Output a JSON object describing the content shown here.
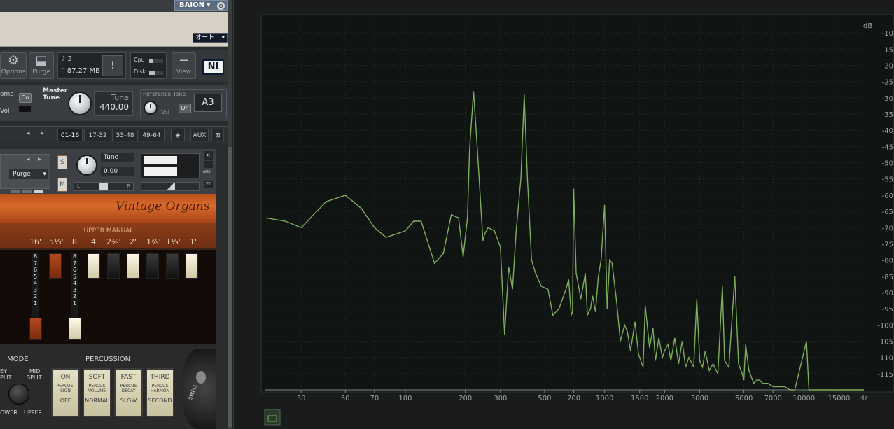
{
  "header": {
    "instrument_name": "BAION",
    "mode_dropdown": "オート"
  },
  "toolbar": {
    "options_label": "Options",
    "purge_label": "Purge",
    "view_label": "View",
    "voices": "2",
    "memory": "87.27 MB",
    "alert": "!",
    "cpu_label": "Cpu",
    "disk_label": "Disk",
    "cpu_level": 0.25,
    "disk_level": 0.45,
    "logo": "NI"
  },
  "master": {
    "metronome_label": "ome",
    "on": "On",
    "vol_label": "Vol",
    "master_tune_label": "Master\nTune",
    "tune_title": "Tune",
    "tune_value": "440.00",
    "reference_tone_label": "Reference Tone",
    "ref_vol_label": "Vol",
    "ref_on": "On",
    "ref_note": "A3"
  },
  "rack": {
    "pages": [
      "01-16",
      "17-32",
      "33-48",
      "49-64"
    ],
    "aux_label": "AUX"
  },
  "instrument": {
    "purge_label": "Purge",
    "s_label": "S",
    "m_label": "M",
    "tune_label": "Tune",
    "tune_value": "0.00",
    "pan_left": "L",
    "pan_right": "R",
    "aux_small": "AUX",
    "pv_small": "PV",
    "brand": "Vintage Organs"
  },
  "organ": {
    "manual_label": "UPPER MANUAL",
    "footages": [
      "16'",
      "5⅓'",
      "8'",
      "4'",
      "2⅔'",
      "2'",
      "1⅗'",
      "1⅓'",
      "1'"
    ],
    "drawbar_levels": [
      8,
      0,
      8,
      0,
      0,
      0,
      0,
      0,
      0
    ],
    "scale_numbers": [
      "8",
      "7",
      "6",
      "5",
      "4",
      "3",
      "2",
      "1"
    ],
    "mode_label": "MODE",
    "percussion_label": "PERCUSSION",
    "mode_labels": {
      "key_split": "EY\nPLIT",
      "midi_split": "MIDI\nSPLIT",
      "lower": "OWER",
      "upper": "UPPER"
    },
    "percussion_buttons": [
      {
        "top": "ON",
        "mid": "PERCUS-\nSION",
        "bottom": "OFF"
      },
      {
        "top": "SOFT",
        "mid": "PERCUS\nVOLUME",
        "bottom": "NORMAL"
      },
      {
        "top": "FAST",
        "mid": "PERCUS\nDECAY",
        "bottom": "SLOW"
      },
      {
        "top": "THIRD",
        "mid": "PERCUS\nHARMON",
        "bottom": "SECOND"
      }
    ],
    "swell_label": "SWELL"
  },
  "chart_data": {
    "type": "line",
    "title": "",
    "xlabel": "Hz",
    "ylabel": "dB",
    "x_scale": "log",
    "x_ticks": [
      30,
      50,
      70,
      100,
      200,
      300,
      500,
      700,
      1000,
      1500,
      2000,
      3000,
      5000,
      7000,
      10000,
      15000
    ],
    "x_tick_labels": [
      "30",
      "50",
      "70",
      "100",
      "200",
      "300",
      "500",
      "700",
      "1000",
      "1500",
      "2000",
      "3000",
      "5000",
      "7000",
      "10000",
      "15000"
    ],
    "y_ticks": [
      -10,
      -15,
      -20,
      -25,
      -30,
      -35,
      -40,
      -45,
      -50,
      -55,
      -60,
      -65,
      -70,
      -75,
      -80,
      -85,
      -90,
      -95,
      -100,
      -105,
      -110,
      -115
    ],
    "y_tick_labels": [
      "-10",
      "-15",
      "-20",
      "-25",
      "-30",
      "-35",
      "-40",
      "-45",
      "-50",
      "-55",
      "-60",
      "-65",
      "-70",
      "-75",
      "-80",
      "-85",
      "-90",
      "-95",
      "-100",
      "-105",
      "-110",
      "-115"
    ],
    "y_unit_label": "dB",
    "ylim": [
      -120,
      -5
    ],
    "xlim": [
      20,
      20000
    ],
    "grid": true,
    "line_color": "#7fae5c",
    "series": [
      {
        "x": [
          20,
          25,
          30,
          40,
          50,
          60,
          70,
          80,
          100,
          110,
          120,
          140,
          155,
          170,
          185,
          195,
          205,
          210,
          220,
          230,
          245,
          250,
          260,
          280,
          300,
          315,
          330,
          345,
          360,
          380,
          395,
          410,
          430,
          450,
          480,
          520,
          550,
          590,
          640,
          660,
          680,
          690,
          700,
          720,
          760,
          800,
          820,
          850,
          870,
          900,
          930,
          960,
          1000,
          1030,
          1060,
          1090,
          1150,
          1200,
          1260,
          1300,
          1350,
          1420,
          1480,
          1560,
          1600,
          1680,
          1750,
          1800,
          1870,
          1950,
          2000,
          2080,
          2150,
          2250,
          2350,
          2450,
          2550,
          2650,
          2800,
          2900,
          3000,
          3100,
          3200,
          3350,
          3500,
          3700,
          3900,
          4000,
          4200,
          4500,
          4700,
          4900,
          5000,
          5100,
          5300,
          5600,
          5800,
          6000,
          6200,
          6600,
          7000,
          7400,
          7800,
          8000,
          8500,
          9000,
          10300,
          10600,
          10800,
          11200,
          12000,
          15000,
          20000
        ],
        "y": [
          -67,
          -68,
          -70,
          -62,
          -60,
          -64,
          -70,
          -73,
          -71,
          -68,
          -68,
          -81,
          -78,
          -66,
          -67,
          -79,
          -67,
          -46,
          -28,
          -46,
          -74,
          -72,
          -70,
          -71,
          -76,
          -103,
          -82,
          -89,
          -71,
          -55,
          -29,
          -55,
          -80,
          -84,
          -88,
          -89,
          -97,
          -95,
          -89,
          -86,
          -97,
          -96,
          -58,
          -84,
          -92,
          -84,
          -97,
          -95,
          -91,
          -96,
          -85,
          -80,
          -63,
          -95,
          -80,
          -81,
          -93,
          -105,
          -100,
          -102,
          -108,
          -99,
          -109,
          -113,
          -94,
          -107,
          -101,
          -111,
          -104,
          -110,
          -108,
          -106,
          -111,
          -104,
          -112,
          -105,
          -113,
          -110,
          -113,
          -92,
          -111,
          -113,
          -108,
          -114,
          -112,
          -115,
          -88,
          -111,
          -113,
          -85,
          -112,
          -115,
          -117,
          -106,
          -114,
          -118,
          -117,
          -117,
          -118,
          -118,
          -119,
          -119,
          -119,
          -119,
          -120,
          -120,
          -105,
          -120,
          -120,
          -120,
          -120,
          -120,
          -120
        ]
      }
    ]
  }
}
